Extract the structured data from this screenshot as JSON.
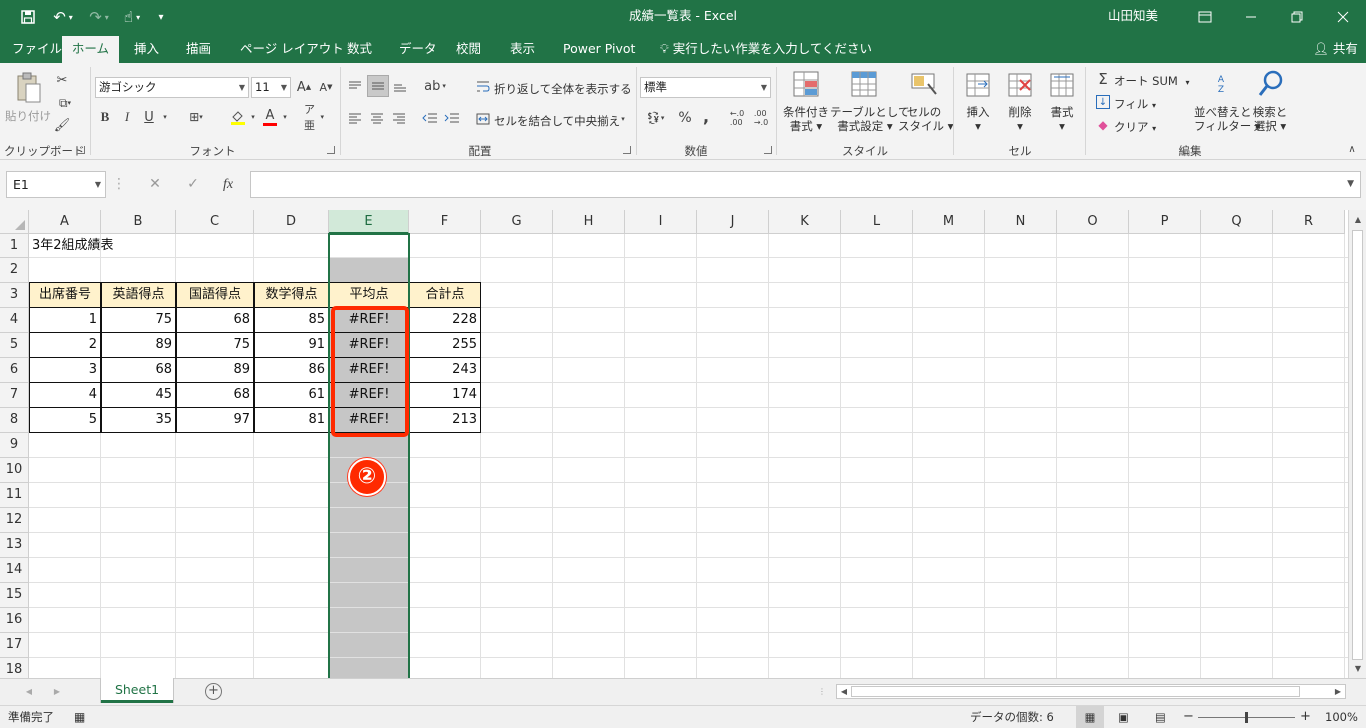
{
  "window": {
    "title": "成績一覧表 - Excel",
    "user": "山田知美",
    "qat": {
      "save": "save-icon",
      "undo": "undo-icon",
      "redo": "redo-icon",
      "touch": "touch-mode-icon",
      "customize": "customize-icon"
    }
  },
  "tabs": [
    {
      "label": "ファイル"
    },
    {
      "label": "ホーム"
    },
    {
      "label": "挿入"
    },
    {
      "label": "描画"
    },
    {
      "label": "ページ レイアウト"
    },
    {
      "label": "数式"
    },
    {
      "label": "データ"
    },
    {
      "label": "校閲"
    },
    {
      "label": "表示"
    },
    {
      "label": "Power Pivot"
    }
  ],
  "tellme": "実行したい作業を入力してください",
  "share": "共有",
  "ribbon": {
    "clipboard": {
      "label": "クリップボード",
      "paste": "貼り付け"
    },
    "font": {
      "label": "フォント",
      "name": "游ゴシック",
      "size": "11",
      "bold": "B",
      "italic": "I",
      "underline": "U",
      "grow": "A",
      "shrink": "A",
      "colorA": "A"
    },
    "alignment": {
      "label": "配置",
      "wrap": "折り返して全体を表示する",
      "merge": "セルを結合して中央揃え"
    },
    "number": {
      "label": "数値",
      "format": "標準",
      "percent": "%",
      "comma": ","
    },
    "styles": {
      "label": "スタイル",
      "cond_line1": "条件付き",
      "cond_line2": "書式",
      "table_line1": "テーブルとして",
      "table_line2": "書式設定",
      "cell_line1": "セルの",
      "cell_line2": "スタイル"
    },
    "cells": {
      "label": "セル",
      "insert": "挿入",
      "delete": "削除",
      "format": "書式"
    },
    "editing": {
      "label": "編集",
      "autosum": "オート SUM",
      "fill": "フィル",
      "clear": "クリア",
      "sort_line1": "並べ替えと",
      "sort_line2": "フィルター",
      "find_line1": "検索と",
      "find_line2": "選択"
    }
  },
  "formula_bar": {
    "name_box": "E1",
    "fx": "fx",
    "cancel": "✕",
    "enter": "✓",
    "value": ""
  },
  "grid": {
    "columns": [
      "A",
      "B",
      "C",
      "D",
      "E",
      "F",
      "G",
      "H",
      "I",
      "J",
      "K",
      "L",
      "M",
      "N",
      "O",
      "P",
      "Q",
      "R"
    ],
    "rows": [
      "1",
      "2",
      "3",
      "4",
      "5",
      "6",
      "7",
      "8",
      "9",
      "10",
      "11",
      "12",
      "13",
      "14",
      "15",
      "16",
      "17",
      "18"
    ],
    "selected_column": "E",
    "title_cell": "3年2組成績表",
    "headers": [
      "出席番号",
      "英語得点",
      "国語得点",
      "数学得点",
      "平均点",
      "合計点"
    ],
    "data": [
      [
        "1",
        "75",
        "68",
        "85",
        "#REF!",
        "228"
      ],
      [
        "2",
        "89",
        "75",
        "91",
        "#REF!",
        "255"
      ],
      [
        "3",
        "68",
        "89",
        "86",
        "#REF!",
        "243"
      ],
      [
        "4",
        "45",
        "68",
        "61",
        "#REF!",
        "174"
      ],
      [
        "5",
        "35",
        "97",
        "81",
        "#REF!",
        "213"
      ]
    ],
    "header_fill": "#fff2cc",
    "annotation": "②",
    "annotation_color": "#ff2a00"
  },
  "sheets": [
    {
      "label": "Sheet1"
    }
  ],
  "status": {
    "ready": "準備完了",
    "count": "データの個数: 6",
    "zoom": "100%",
    "zoom_minus": "−",
    "zoom_plus": "+"
  }
}
